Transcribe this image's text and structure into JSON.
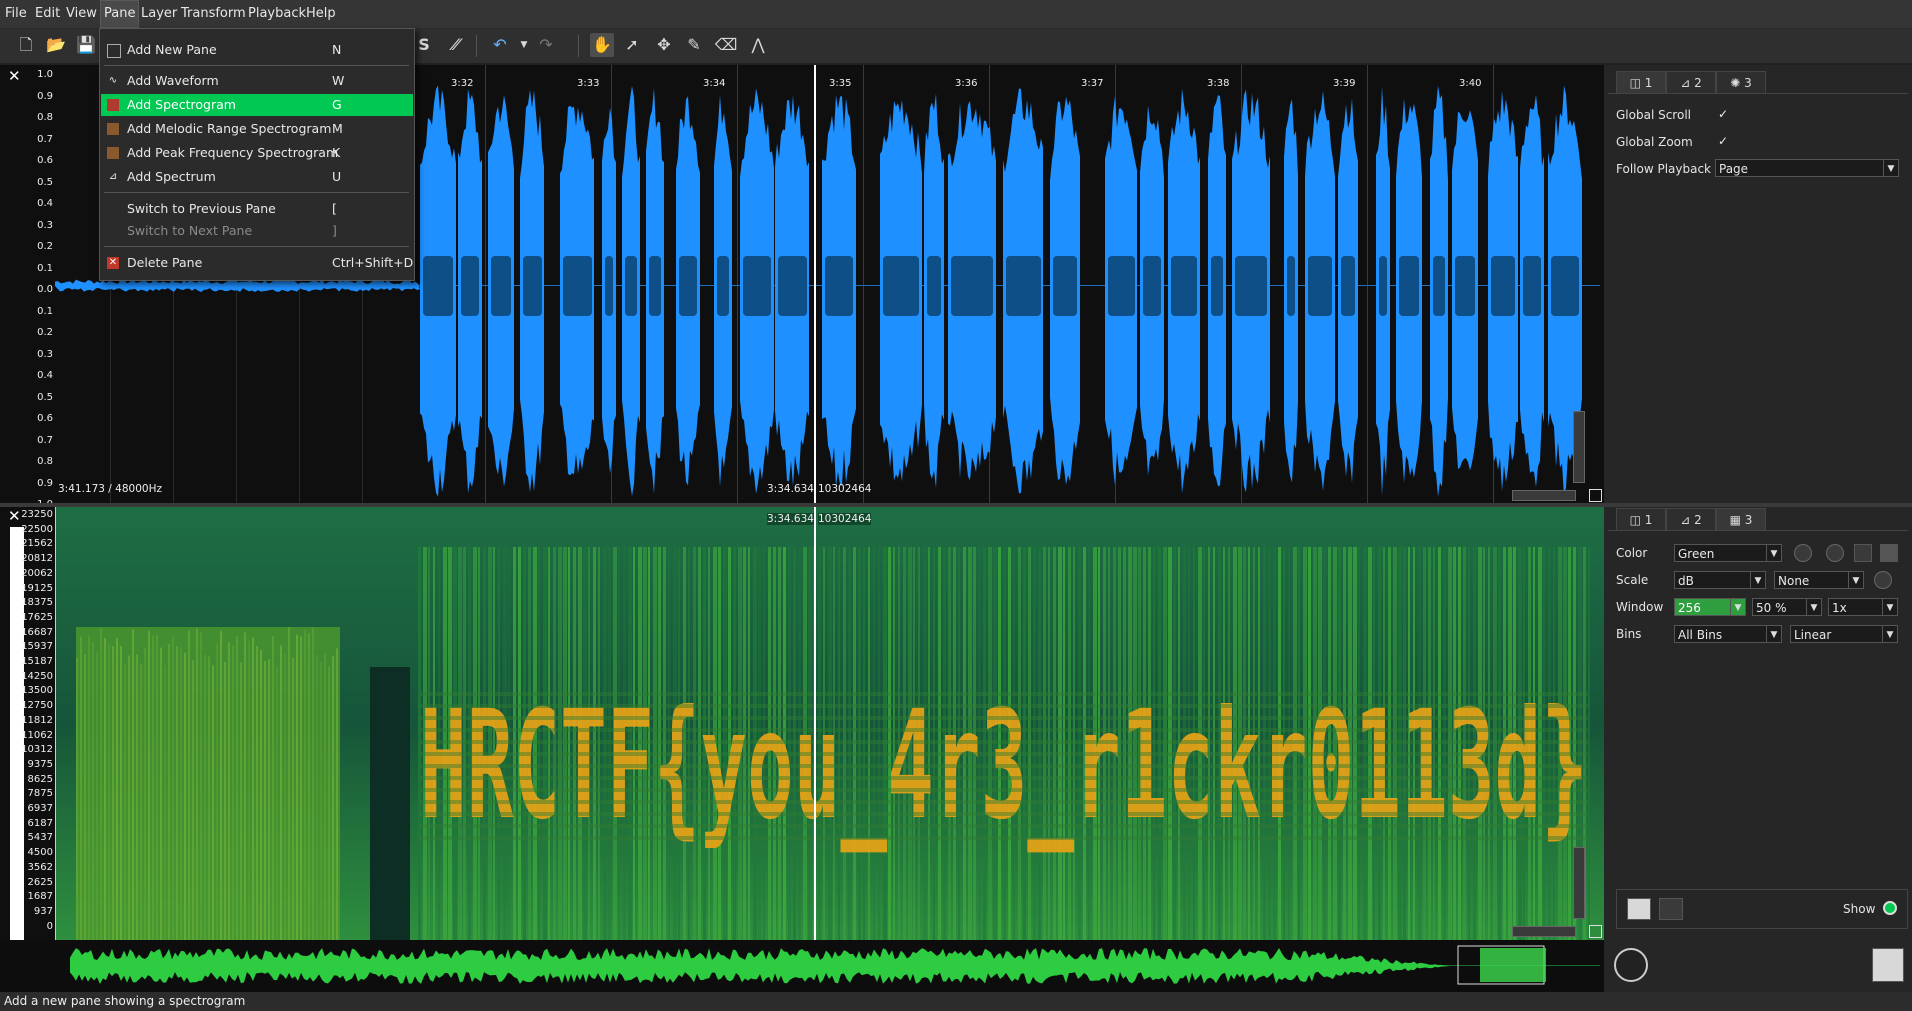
{
  "menubar": {
    "items": [
      "File",
      "Edit",
      "View",
      "Pane",
      "Layer",
      "Transform",
      "Playback",
      "Help"
    ],
    "open_menu": "Pane"
  },
  "pane_menu": {
    "items": [
      {
        "label": "Add New Pane",
        "shortcut": "N",
        "icon": "pane-icon",
        "enabled": true,
        "highlighted": false
      },
      {
        "label": "Add Waveform",
        "shortcut": "W",
        "icon": "waveform-icon",
        "enabled": true,
        "highlighted": false
      },
      {
        "label": "Add Spectrogram",
        "shortcut": "G",
        "icon": "spectrogram-icon",
        "enabled": true,
        "highlighted": true
      },
      {
        "label": "Add Melodic Range Spectrogram",
        "shortcut": "M",
        "icon": "melodic-spectrogram-icon",
        "enabled": true,
        "highlighted": false
      },
      {
        "label": "Add Peak Frequency Spectrogram",
        "shortcut": "K",
        "icon": "peak-frequency-icon",
        "enabled": true,
        "highlighted": false
      },
      {
        "label": "Add Spectrum",
        "shortcut": "U",
        "icon": "spectrum-icon",
        "enabled": true,
        "highlighted": false
      },
      {
        "label": "Switch to Previous Pane",
        "shortcut": "[",
        "icon": "",
        "enabled": true,
        "highlighted": false
      },
      {
        "label": "Switch to Next Pane",
        "shortcut": "]",
        "icon": "",
        "enabled": false,
        "highlighted": false
      },
      {
        "label": "Delete Pane",
        "shortcut": "Ctrl+Shift+D",
        "icon": "delete-icon",
        "enabled": true,
        "highlighted": false
      }
    ]
  },
  "waveform": {
    "scale_labels": [
      "1.0",
      "0.9",
      "0.8",
      "0.7",
      "0.6",
      "0.5",
      "0.4",
      "0.3",
      "0.2",
      "0.1",
      "0.0",
      "0.1",
      "0.2",
      "0.3",
      "0.4",
      "0.5",
      "0.6",
      "0.7",
      "0.8",
      "0.9",
      "1.0"
    ],
    "time_labels": [
      "3:32",
      "3:33",
      "3:34",
      "3:35",
      "3:36",
      "3:37",
      "3:38",
      "3:39",
      "3:40"
    ],
    "position_readout": "3:41.173 / 48000Hz",
    "cursor_time": "3:34.634",
    "cursor_frame": "10302464",
    "color": "#1e90ff"
  },
  "spectrogram": {
    "freq_labels": [
      "23250",
      "22500",
      "21562",
      "20812",
      "20062",
      "19125",
      "18375",
      "17625",
      "16687",
      "15937",
      "15187",
      "14250",
      "13500",
      "12750",
      "11812",
      "11062",
      "10312",
      "9375",
      "8625",
      "7875",
      "6937",
      "6187",
      "5437",
      "4500",
      "3562",
      "2625",
      "1687",
      "937",
      "0"
    ],
    "cursor_time": "3:34.634",
    "cursor_frame": "10302464",
    "hidden_text": "HRCTF{you_4r3_r1ckr0113d}"
  },
  "top_panel": {
    "tabs": [
      "1",
      "2",
      "3"
    ],
    "global_scroll_label": "Global Scroll",
    "global_scroll": true,
    "global_zoom_label": "Global Zoom",
    "global_zoom": true,
    "follow_playback_label": "Follow Playback",
    "follow_playback": "Page"
  },
  "spec_panel": {
    "tabs": [
      "1",
      "2",
      "3"
    ],
    "color_label": "Color",
    "color": "Green",
    "scale_label": "Scale",
    "scale": "dB",
    "scale_norm": "None",
    "window_label": "Window",
    "window_size": "256",
    "window_overlap": "50 %",
    "window_mult": "1x",
    "bins_label": "Bins",
    "bins": "All Bins",
    "bins_scale": "Linear",
    "show_label": "Show"
  },
  "status": {
    "text": "Add a new pane showing a spectrogram"
  },
  "colors": {
    "accent": "#00c853",
    "waveform": "#1e90ff",
    "spectrogram_bg": "#1c6b3c",
    "spectrogram_text": "#e8a317"
  }
}
